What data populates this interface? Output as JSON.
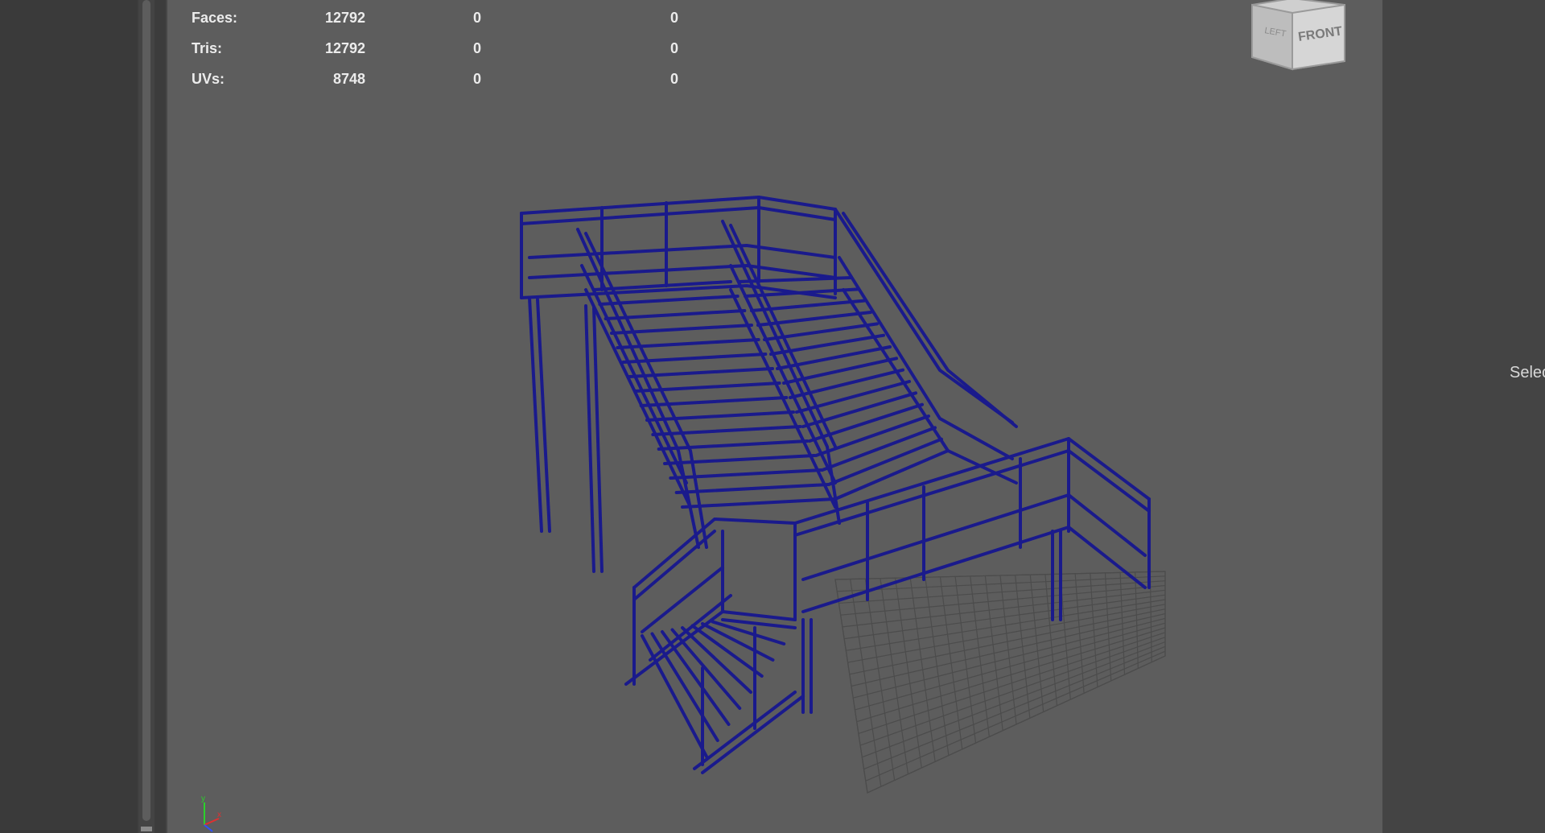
{
  "hud": {
    "rows": [
      {
        "label": "Faces:",
        "v1": "12792",
        "v2": "0",
        "v3": "0"
      },
      {
        "label": "Tris:",
        "v1": "12792",
        "v2": "0",
        "v3": "0"
      },
      {
        "label": "UVs:",
        "v1": "8748",
        "v2": "0",
        "v3": "0"
      }
    ]
  },
  "viewcube": {
    "left_label": "LEFT",
    "front_label": "FRONT"
  },
  "axis": {
    "y_label": "y",
    "x_label": "x"
  },
  "right_panel": {
    "partial_text": "Selec"
  },
  "colors": {
    "wireframe": "#1a1a8c",
    "viewport_bg": "#5d5d5d",
    "grid": "#4c4c4c"
  }
}
